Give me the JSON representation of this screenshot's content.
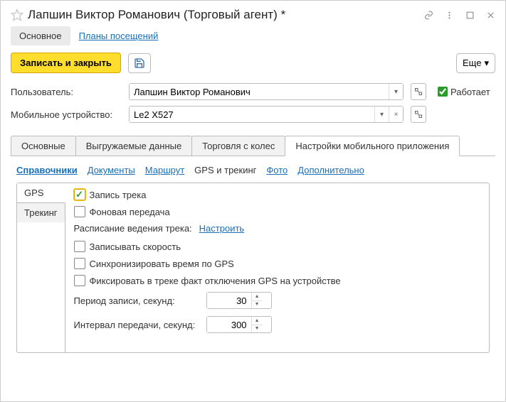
{
  "title": "Лапшин Виктор Романович (Торговый агент) *",
  "nav": {
    "main": "Основное",
    "plans": "Планы посещений"
  },
  "toolbar": {
    "save_close": "Записать и закрыть",
    "more": "Еще"
  },
  "form": {
    "user_label": "Пользователь:",
    "user_value": "Лапшин Виктор Романович",
    "device_label": "Мобильное устройство:",
    "device_value": "Le2 X527",
    "works_label": "Работает"
  },
  "tabs2": {
    "main": "Основные",
    "upload": "Выгружаемые данные",
    "trade": "Торговля с колес",
    "mobile": "Настройки мобильного приложения"
  },
  "links": {
    "catalogs": "Справочники",
    "docs": "Документы",
    "route": "Маршрут",
    "gps": "GPS и трекинг",
    "photo": "Фото",
    "extra": "Дополнительно"
  },
  "side": {
    "gps": "GPS",
    "tracking": "Трекинг"
  },
  "gps": {
    "record": "Запись трека",
    "background": "Фоновая передача",
    "schedule_label": "Расписание ведения трека:",
    "schedule_link": "Настроить",
    "speed": "Записывать скорость",
    "sync_time": "Синхронизировать время по GPS",
    "fix_off": "Фиксировать в треке факт отключения GPS на устройстве",
    "period_label": "Период записи, секунд:",
    "period_value": "30",
    "interval_label": "Интервал передачи, секунд:",
    "interval_value": "300"
  }
}
